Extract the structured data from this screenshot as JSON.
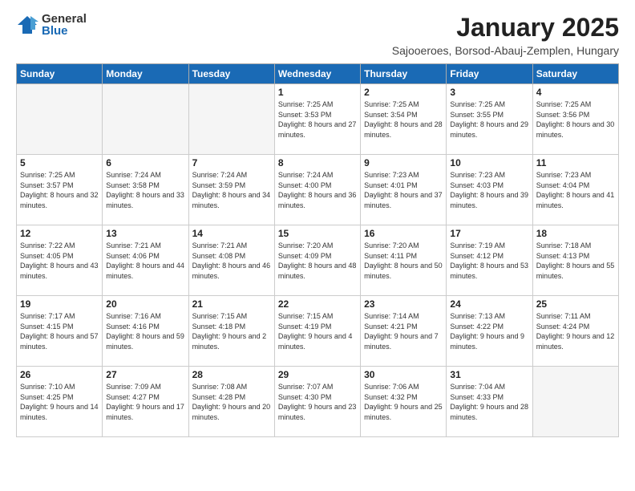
{
  "logo": {
    "general": "General",
    "blue": "Blue"
  },
  "title": "January 2025",
  "location": "Sajooeroes, Borsod-Abauj-Zemplen, Hungary",
  "headers": [
    "Sunday",
    "Monday",
    "Tuesday",
    "Wednesday",
    "Thursday",
    "Friday",
    "Saturday"
  ],
  "weeks": [
    [
      {
        "day": "",
        "info": ""
      },
      {
        "day": "",
        "info": ""
      },
      {
        "day": "",
        "info": ""
      },
      {
        "day": "1",
        "info": "Sunrise: 7:25 AM\nSunset: 3:53 PM\nDaylight: 8 hours and 27 minutes."
      },
      {
        "day": "2",
        "info": "Sunrise: 7:25 AM\nSunset: 3:54 PM\nDaylight: 8 hours and 28 minutes."
      },
      {
        "day": "3",
        "info": "Sunrise: 7:25 AM\nSunset: 3:55 PM\nDaylight: 8 hours and 29 minutes."
      },
      {
        "day": "4",
        "info": "Sunrise: 7:25 AM\nSunset: 3:56 PM\nDaylight: 8 hours and 30 minutes."
      }
    ],
    [
      {
        "day": "5",
        "info": "Sunrise: 7:25 AM\nSunset: 3:57 PM\nDaylight: 8 hours and 32 minutes."
      },
      {
        "day": "6",
        "info": "Sunrise: 7:24 AM\nSunset: 3:58 PM\nDaylight: 8 hours and 33 minutes."
      },
      {
        "day": "7",
        "info": "Sunrise: 7:24 AM\nSunset: 3:59 PM\nDaylight: 8 hours and 34 minutes."
      },
      {
        "day": "8",
        "info": "Sunrise: 7:24 AM\nSunset: 4:00 PM\nDaylight: 8 hours and 36 minutes."
      },
      {
        "day": "9",
        "info": "Sunrise: 7:23 AM\nSunset: 4:01 PM\nDaylight: 8 hours and 37 minutes."
      },
      {
        "day": "10",
        "info": "Sunrise: 7:23 AM\nSunset: 4:03 PM\nDaylight: 8 hours and 39 minutes."
      },
      {
        "day": "11",
        "info": "Sunrise: 7:23 AM\nSunset: 4:04 PM\nDaylight: 8 hours and 41 minutes."
      }
    ],
    [
      {
        "day": "12",
        "info": "Sunrise: 7:22 AM\nSunset: 4:05 PM\nDaylight: 8 hours and 43 minutes."
      },
      {
        "day": "13",
        "info": "Sunrise: 7:21 AM\nSunset: 4:06 PM\nDaylight: 8 hours and 44 minutes."
      },
      {
        "day": "14",
        "info": "Sunrise: 7:21 AM\nSunset: 4:08 PM\nDaylight: 8 hours and 46 minutes."
      },
      {
        "day": "15",
        "info": "Sunrise: 7:20 AM\nSunset: 4:09 PM\nDaylight: 8 hours and 48 minutes."
      },
      {
        "day": "16",
        "info": "Sunrise: 7:20 AM\nSunset: 4:11 PM\nDaylight: 8 hours and 50 minutes."
      },
      {
        "day": "17",
        "info": "Sunrise: 7:19 AM\nSunset: 4:12 PM\nDaylight: 8 hours and 53 minutes."
      },
      {
        "day": "18",
        "info": "Sunrise: 7:18 AM\nSunset: 4:13 PM\nDaylight: 8 hours and 55 minutes."
      }
    ],
    [
      {
        "day": "19",
        "info": "Sunrise: 7:17 AM\nSunset: 4:15 PM\nDaylight: 8 hours and 57 minutes."
      },
      {
        "day": "20",
        "info": "Sunrise: 7:16 AM\nSunset: 4:16 PM\nDaylight: 8 hours and 59 minutes."
      },
      {
        "day": "21",
        "info": "Sunrise: 7:15 AM\nSunset: 4:18 PM\nDaylight: 9 hours and 2 minutes."
      },
      {
        "day": "22",
        "info": "Sunrise: 7:15 AM\nSunset: 4:19 PM\nDaylight: 9 hours and 4 minutes."
      },
      {
        "day": "23",
        "info": "Sunrise: 7:14 AM\nSunset: 4:21 PM\nDaylight: 9 hours and 7 minutes."
      },
      {
        "day": "24",
        "info": "Sunrise: 7:13 AM\nSunset: 4:22 PM\nDaylight: 9 hours and 9 minutes."
      },
      {
        "day": "25",
        "info": "Sunrise: 7:11 AM\nSunset: 4:24 PM\nDaylight: 9 hours and 12 minutes."
      }
    ],
    [
      {
        "day": "26",
        "info": "Sunrise: 7:10 AM\nSunset: 4:25 PM\nDaylight: 9 hours and 14 minutes."
      },
      {
        "day": "27",
        "info": "Sunrise: 7:09 AM\nSunset: 4:27 PM\nDaylight: 9 hours and 17 minutes."
      },
      {
        "day": "28",
        "info": "Sunrise: 7:08 AM\nSunset: 4:28 PM\nDaylight: 9 hours and 20 minutes."
      },
      {
        "day": "29",
        "info": "Sunrise: 7:07 AM\nSunset: 4:30 PM\nDaylight: 9 hours and 23 minutes."
      },
      {
        "day": "30",
        "info": "Sunrise: 7:06 AM\nSunset: 4:32 PM\nDaylight: 9 hours and 25 minutes."
      },
      {
        "day": "31",
        "info": "Sunrise: 7:04 AM\nSunset: 4:33 PM\nDaylight: 9 hours and 28 minutes."
      },
      {
        "day": "",
        "info": ""
      }
    ]
  ]
}
